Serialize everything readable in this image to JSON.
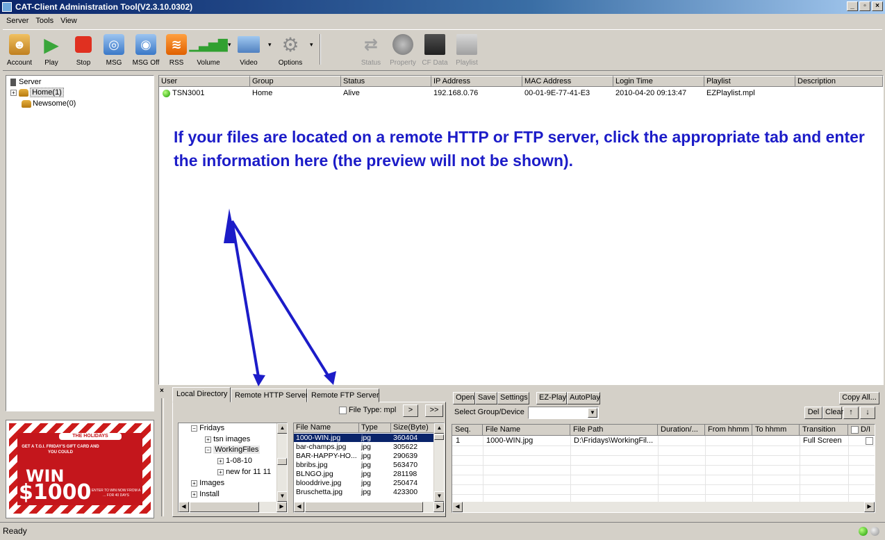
{
  "window": {
    "title": "CAT-Client Administration Tool(V2.3.10.0302)"
  },
  "menu": [
    "Server",
    "Tools",
    "View"
  ],
  "toolbar": {
    "buttons": [
      "Account",
      "Play",
      "Stop",
      "MSG",
      "MSG Off",
      "RSS",
      "Volume",
      "Video",
      "Options"
    ],
    "disabled_buttons": [
      "Status",
      "Property",
      "CF Data",
      "Playlist"
    ]
  },
  "left_tree": {
    "root": "Server",
    "items": [
      "Home(1)",
      "Newsome(0)"
    ]
  },
  "device_grid": {
    "columns": [
      "User",
      "Group",
      "Status",
      "IP Address",
      "MAC Address",
      "Login Time",
      "Playlist",
      "Description"
    ],
    "rows": [
      [
        "TSN3001",
        "Home",
        "Alive",
        "192.168.0.76",
        "00-01-9E-77-41-E3",
        "2010-04-20 09:13:47",
        "EZPlaylist.mpl",
        ""
      ]
    ]
  },
  "annotation": {
    "text": "If your files are located on a remote HTTP or FTP server, click the appropriate tab and enter the information here (the preview will not be shown).",
    "color": "#1c1cc8"
  },
  "ad": {
    "banner": "THE HOLIDAYS",
    "headline": "GET A T.G.I. FRIDAY'S GIFT CARD AND YOU COULD",
    "win": "WIN",
    "amount": "$1000",
    "fine_print": "ENTER TO WIN NOW FROM A ... FOR 40 DAYS"
  },
  "bottom_panel": {
    "close": "×",
    "tabs": [
      "Local Directory",
      "Remote HTTP Server",
      "Remote FTP Server"
    ],
    "file_type_label": "File Type: mpl",
    "nav_buttons": [
      ">",
      ">>"
    ],
    "dir_tree": [
      "Fridays",
      "tsn images",
      "WorkingFiles",
      "1-08-10",
      "new for 11 11",
      "Images",
      "Install"
    ],
    "file_columns": [
      "File Name",
      "Type",
      "Size(Byte)"
    ],
    "files": [
      [
        "1000-WIN.jpg",
        "jpg",
        "360404"
      ],
      [
        "bar-champs.jpg",
        "jpg",
        "305622"
      ],
      [
        "BAR-HAPPY-HO...",
        "jpg",
        "290639"
      ],
      [
        "bbribs.jpg",
        "jpg",
        "563470"
      ],
      [
        "BLNGO.jpg",
        "jpg",
        "281198"
      ],
      [
        "blooddrive.jpg",
        "jpg",
        "250474"
      ],
      [
        "Bruschetta.jpg",
        "jpg",
        "423300"
      ]
    ]
  },
  "playlist_panel": {
    "buttons": [
      "Open",
      "Save",
      "Settings",
      "EZ-Play",
      "AutoPlay"
    ],
    "copy_all": "Copy All...",
    "select_label": "Select Group/Device",
    "edit_buttons": [
      "Del",
      "Clear",
      "↑",
      "↓"
    ],
    "columns": [
      "Seq.",
      "File Name",
      "File Path",
      "Duration/...",
      "From hhmm",
      "To hhmm",
      "Transition",
      "D/I"
    ],
    "rows": [
      [
        "1",
        "1000-WIN.jpg",
        "D:\\Fridays\\WorkingFil...",
        "",
        "",
        "",
        "Full Screen",
        ""
      ]
    ]
  },
  "status": {
    "text": "Ready"
  }
}
